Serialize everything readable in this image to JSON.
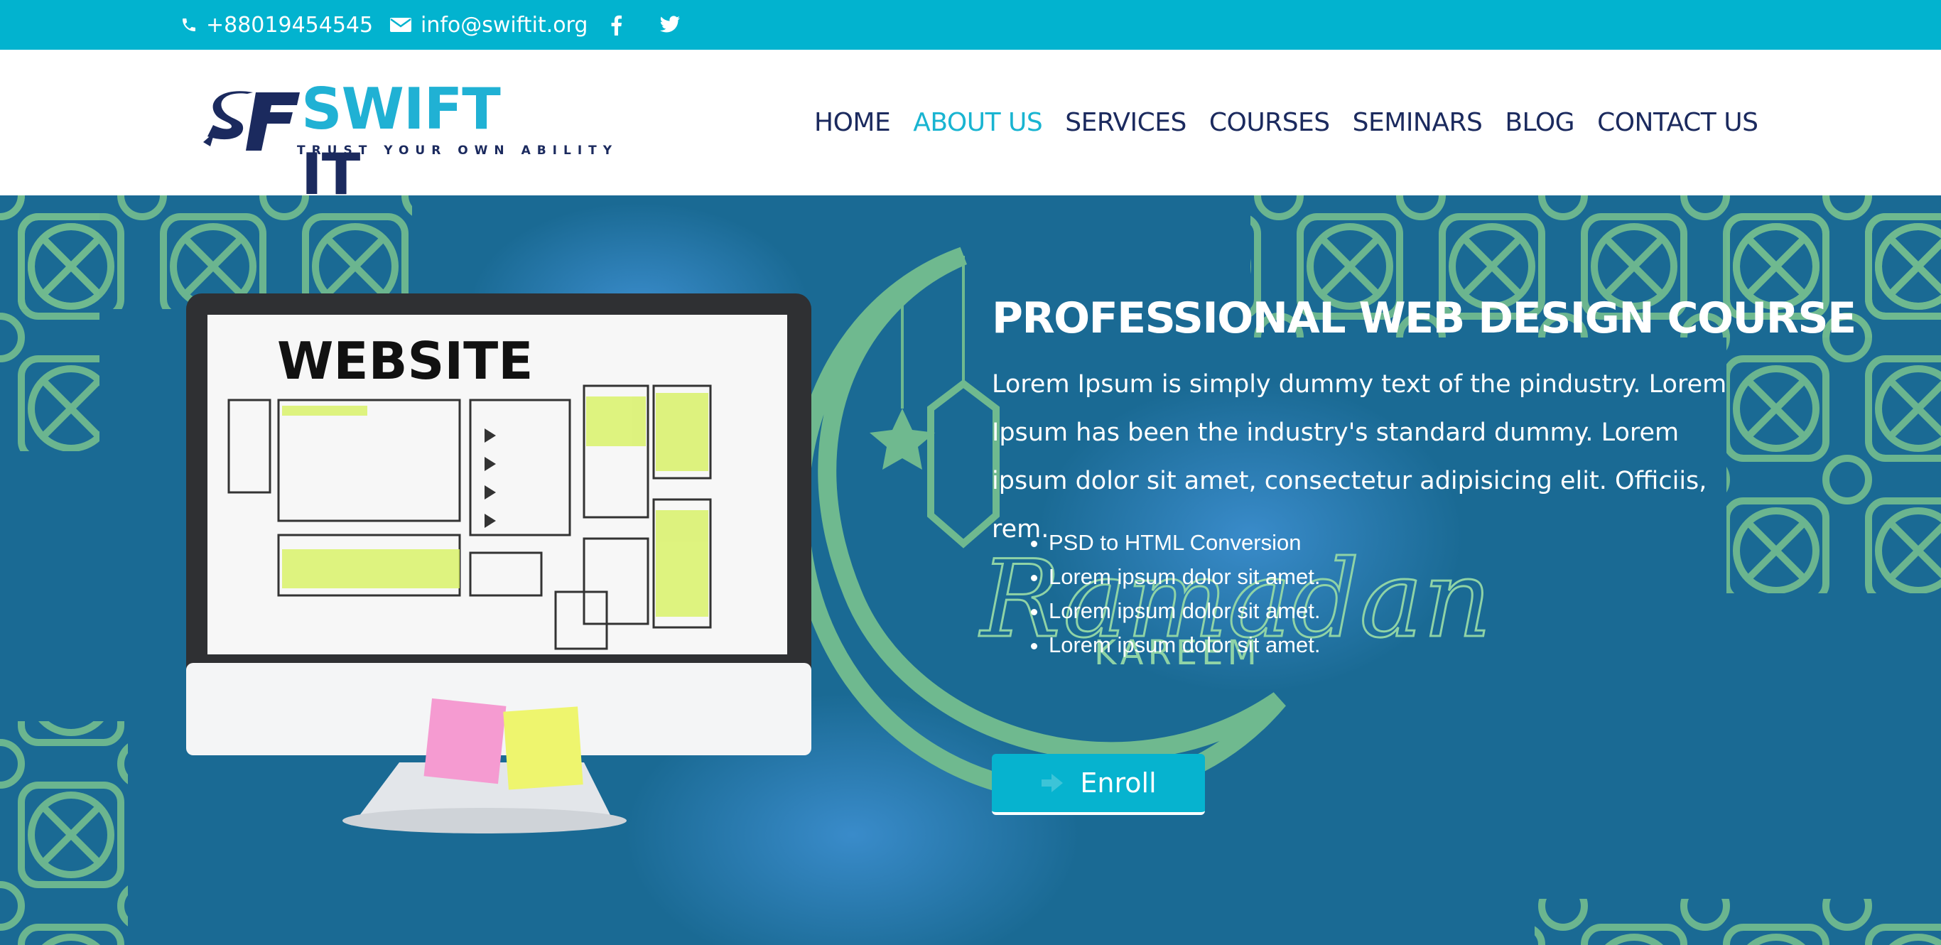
{
  "topbar": {
    "phone": "+88019454545",
    "email": "info@swiftit.org",
    "icons": [
      "phone-icon",
      "envelope-icon",
      "facebook-icon",
      "twitter-icon"
    ]
  },
  "logo": {
    "brand": "SWIFT",
    "brand_suffix": "IT",
    "mark": "SF",
    "tagline": "TRUST YOUR OWN ABILITY"
  },
  "nav": {
    "items": [
      {
        "label": "HOME",
        "active": false
      },
      {
        "label": "ABOUT US",
        "active": true
      },
      {
        "label": "SERVICES",
        "active": false
      },
      {
        "label": "COURSES",
        "active": false
      },
      {
        "label": "SEMINARS",
        "active": false
      },
      {
        "label": "BLOG",
        "active": false
      },
      {
        "label": "CONTACT US",
        "active": false
      }
    ]
  },
  "hero": {
    "title": "PROFESSIONAL WEB DESIGN COURSE",
    "description": "Lorem Ipsum is simply dummy text of the pindustry. Lorem Ipsum has been the industry's standard dummy. Lorem ipsum dolor sit amet, consectetur adipisicing elit. Officiis, rem.",
    "bullets": [
      "PSD to HTML Conversion",
      "Lorem ipsum dolor sit amet.",
      "Lorem ipsum dolor sit amet.",
      "Lorem ipsum dolor sit amet."
    ],
    "cta": "Enroll",
    "background_text": {
      "script": "Ramadan",
      "caption": "KAREEM"
    },
    "screen_text": "WEBSITE"
  },
  "colors": {
    "topbar": "#02b3cf",
    "nav_text": "#1b2a5e",
    "nav_active": "#19b4d1",
    "hero_bg": "#1a6a94",
    "pattern": "#6fb98f",
    "button": "#06b3cf"
  }
}
